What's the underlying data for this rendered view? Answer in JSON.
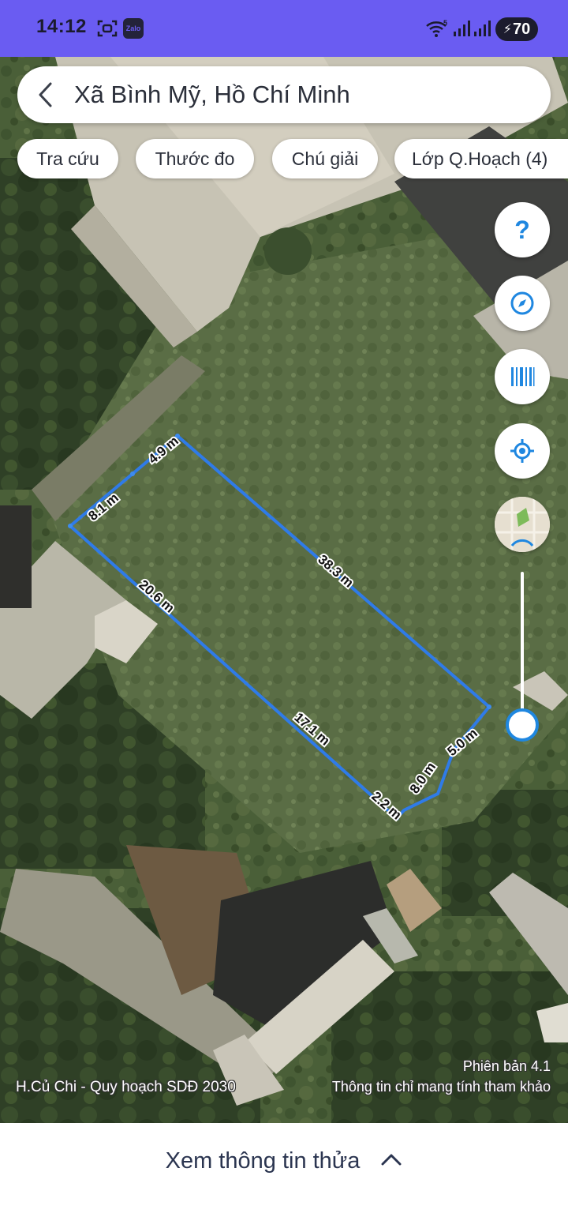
{
  "status_bar": {
    "time": "14:12",
    "battery": "70",
    "icons": [
      "scan-icon",
      "zalo-icon",
      "wifi-icon",
      "signal-icon",
      "signal-icon",
      "battery-charging-icon"
    ],
    "zalo_label": "Zalo",
    "wifi_label": "5",
    "color": "#6a5cf2"
  },
  "search": {
    "back_icon": "chevron-left-icon",
    "location": "Xã Bình Mỹ, Hồ Chí Minh"
  },
  "chips": [
    {
      "label": "Tra cứu"
    },
    {
      "label": "Thước đo"
    },
    {
      "label": "Chú giải"
    },
    {
      "label": "Lớp Q.Hoạch (4)"
    }
  ],
  "controls": {
    "help_label": "?",
    "icons": [
      "help-icon",
      "compass-icon",
      "barcode-icon",
      "locate-icon",
      "minimap-icon"
    ],
    "accent": "#1f87e0"
  },
  "measurements": [
    "4.9 m",
    "8.1 m",
    "38.3 m",
    "20.6 m",
    "17.1 m",
    "2.2 m",
    "8.0 m",
    "5.0 m"
  ],
  "map_footer": {
    "layer_name": "H.Củ Chi - Quy hoạch SDĐ 2030",
    "version": "Phiên bản 4.1",
    "disclaimer": "Thông tin chỉ mang tính tham khảo"
  },
  "bottom_sheet": {
    "label": "Xem thông tin thửa",
    "icon": "chevron-up-icon"
  }
}
